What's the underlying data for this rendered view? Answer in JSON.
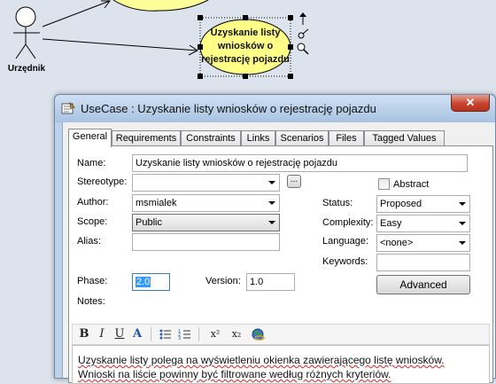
{
  "diagram": {
    "actor_label": "Urzędnik",
    "usecase_label": "Uzyskanie listy wniosków o rejestrację pojazdu"
  },
  "dialog": {
    "title": "UseCase : Uzyskanie listy wniosków o rejestrację pojazdu",
    "close_symbol": "✕",
    "tabs": [
      "General",
      "Requirements",
      "Constraints",
      "Links",
      "Scenarios",
      "Files",
      "Tagged Values"
    ],
    "active_tab": "General",
    "fields": {
      "name_label": "Name:",
      "name_value": "Uzyskanie listy wniosków o rejestrację pojazdu",
      "stereotype_label": "Stereotype:",
      "stereotype_value": "",
      "stereotype_button": "...",
      "abstract_label": "Abstract",
      "author_label": "Author:",
      "author_value": "msmialek",
      "scope_label": "Scope:",
      "scope_value": "Public",
      "alias_label": "Alias:",
      "alias_value": "",
      "status_label": "Status:",
      "status_value": "Proposed",
      "complexity_label": "Complexity:",
      "complexity_value": "Easy",
      "language_label": "Language:",
      "language_value": "<none>",
      "keywords_label": "Keywords:",
      "keywords_value": "",
      "phase_label": "Phase:",
      "phase_value": "2.0",
      "version_label": "Version:",
      "version_value": "1.0",
      "advanced_button": "Advanced",
      "notes_label": "Notes:"
    },
    "notes_toolbar": {
      "bold": "B",
      "italic": "I",
      "underline": "U",
      "font_color": "A",
      "superscript": "x²",
      "subscript": "x₂"
    },
    "notes_text": "Uzyskanie listy polega na wyświetleniu okienka zawierającego listę wniosków. Wnioski na liście powinny być filtrowane według różnych kryteriów."
  }
}
